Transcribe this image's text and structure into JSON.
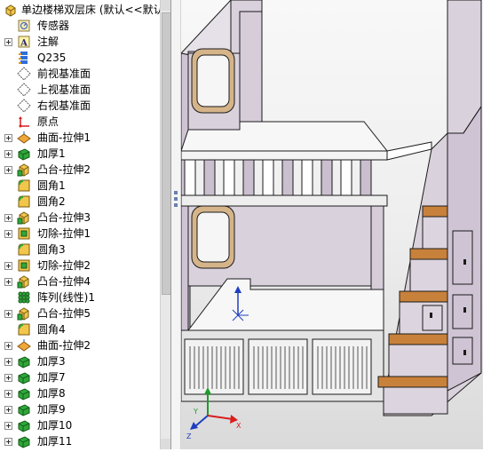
{
  "feature_tree": {
    "root": {
      "label": "单边楼梯双层床  (默认<<默认",
      "icon": "part-icon"
    },
    "items": [
      {
        "label": "传感器",
        "icon": "sensor-icon"
      },
      {
        "label": "注解",
        "icon": "annotation-icon"
      },
      {
        "label": "Q235",
        "icon": "material-icon"
      },
      {
        "label": "前视基准面",
        "icon": "plane-icon"
      },
      {
        "label": "上视基准面",
        "icon": "plane-icon"
      },
      {
        "label": "右视基准面",
        "icon": "plane-icon"
      },
      {
        "label": "原点",
        "icon": "origin-icon"
      },
      {
        "label": "曲面-拉伸1",
        "icon": "surface-extrude-icon"
      },
      {
        "label": "加厚1",
        "icon": "thicken-icon"
      },
      {
        "label": "凸台-拉伸2",
        "icon": "boss-extrude-icon"
      },
      {
        "label": "圆角1",
        "icon": "fillet-icon"
      },
      {
        "label": "圆角2",
        "icon": "fillet-icon"
      },
      {
        "label": "凸台-拉伸3",
        "icon": "boss-extrude-icon"
      },
      {
        "label": "切除-拉伸1",
        "icon": "cut-extrude-icon"
      },
      {
        "label": "圆角3",
        "icon": "fillet-icon"
      },
      {
        "label": "切除-拉伸2",
        "icon": "cut-extrude-icon"
      },
      {
        "label": "凸台-拉伸4",
        "icon": "boss-extrude-icon"
      },
      {
        "label": "阵列(线性)1",
        "icon": "linear-pattern-icon"
      },
      {
        "label": "凸台-拉伸5",
        "icon": "boss-extrude-icon"
      },
      {
        "label": "圆角4",
        "icon": "fillet-icon"
      },
      {
        "label": "曲面-拉伸2",
        "icon": "surface-extrude-icon"
      },
      {
        "label": "加厚3",
        "icon": "thicken-icon"
      },
      {
        "label": "加厚7",
        "icon": "thicken-icon"
      },
      {
        "label": "加厚8",
        "icon": "thicken-icon"
      },
      {
        "label": "加厚9",
        "icon": "thicken-icon"
      },
      {
        "label": "加厚10",
        "icon": "thicken-icon"
      },
      {
        "label": "加厚11",
        "icon": "thicken-icon"
      }
    ]
  },
  "colors": {
    "panel": "#d9d1dc",
    "panel_dark": "#bcb2c0",
    "deck": "#f7f7f7",
    "wood": "#c8813a",
    "wood_dark": "#8f5520",
    "outline": "#1b1b1b",
    "axis_x": "#d81e1e",
    "axis_y": "#1f9a2a",
    "axis_z": "#1f3fbf"
  }
}
